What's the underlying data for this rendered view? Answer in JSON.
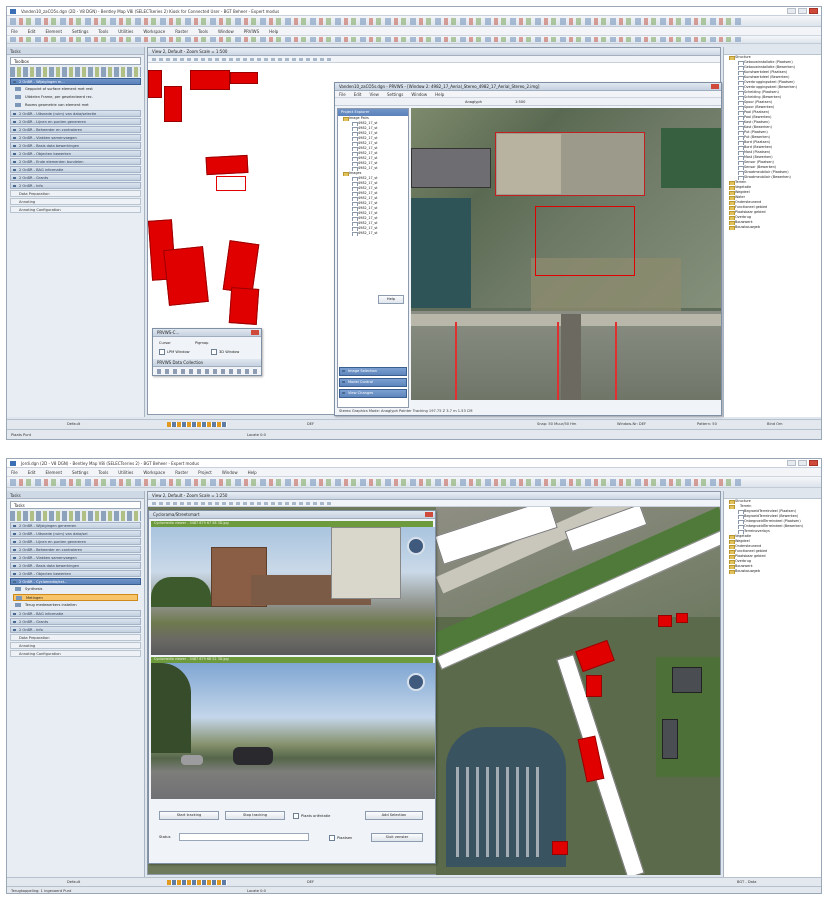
{
  "screenshot1": {
    "title": "Vanden10_zaCO5s.dgn (2D - V8 DGN) - Bentley Map V8i (SELECTseries 2) Kiosk for Connected User - BGT Beheer - Expert modus",
    "menu": [
      "File",
      "Edit",
      "Element",
      "Settings",
      "Tools",
      "Utilities",
      "Workspace",
      "Raster",
      "Tools",
      "Window",
      "PRVIWS",
      "Help"
    ],
    "left_panel": {
      "header": "Tasks",
      "combo": "Toolbox",
      "active_group": "2 OnBR - Wijzigingen m...",
      "active_items": [
        "Geppoint of surface element met rest",
        "Uitdelen Frame, per geselecteerd rec.",
        "Rooms geometrie van element met"
      ],
      "groups": [
        "2 OnBR - Uitsnede (ruim) van data/selectie",
        "2 OnBR - Lijnen en punten genereren",
        "2 OnBR - Beheerder en controleren",
        "2 OnBR - Vlakken samenvoegen",
        "2 OnBR - Basis data bewerkingen",
        "2 OnBR - Objecten bewerken",
        "2 OnBR - Ende elementen bundelen",
        "2 OnBR - BAG informatie",
        "2 OnBR - Grants",
        "2 OnBR - Info"
      ],
      "plain": [
        "Data Preparation",
        "Annoting",
        "Annoting Configuration"
      ]
    },
    "view_title": "View 2, Default - Zoom Scale = 1:500",
    "stereo_window": {
      "title": "Vanden10_zaCO5s.dgn - PRVWS - [Window 2: 4982_17_Aerial_Stereo_4982_17_Aerial_Stereo_2.img]",
      "menu": [
        "File",
        "Edit",
        "View",
        "Settings",
        "Window",
        "Help"
      ],
      "panel_header": "Project Explorer",
      "group_label": "Image Pairs",
      "images_label": "Images",
      "pair_items": [
        "4982_17_st",
        "4982_17_st",
        "4982_17_st",
        "4982_17_st",
        "4982_17_st",
        "4982_17_st",
        "4982_17_st",
        "4982_17_st",
        "4982_17_st",
        "4982_17_st"
      ],
      "image_items": [
        "4982_17_st",
        "4982_17_st",
        "4982_17_st",
        "4982_17_st",
        "4982_17_st",
        "4982_17_st",
        "4982_17_st",
        "4982_17_st",
        "4982_17_st",
        "4982_17_st",
        "4982_17_st",
        "4982_17_st"
      ],
      "help_button": "Help",
      "side_tabs": [
        "Image Selection",
        "Model Control",
        "View Changes"
      ],
      "mode_label": "Anaglyph",
      "zoom_label": "1:500",
      "status": "Stereo Graphics Mode: Anaglyph Pointer Tracking 197.75 Z 3.7 m 1.53 CM"
    },
    "mini_panel": {
      "title": "PRVWS-C...",
      "labels": [
        "Cursor",
        "Pigmap"
      ],
      "checks": [
        "LPM Window",
        "3D Window"
      ],
      "tools_title": "PRVWS Data Collection"
    },
    "right_tree": {
      "root": "Structure",
      "items": [
        "Gebouwinstallatie (Plaatsen)",
        "Gebouwinstallatie (Bewerken)",
        "Kunstwerkdeel (Plaatsen)",
        "Kunstwerkdeel (Bewerken)",
        "Overbruggingsdeel (Plaatsen)",
        "Overbruggingsdeel (Bewerken)",
        "Scheiding (Plaatsen)",
        "Scheiding (Bewerken)",
        "Spoor (Plaatsen)",
        "Spoor (Bewerken)",
        "Paal (Plaatsen)",
        "Paal (Bewerken)",
        "Kast (Plaatsen)",
        "Kast (Bewerken)",
        "Put (Plaatsen)",
        "Put (Bewerken)",
        "Bord (Plaatsen)",
        "Bord (Bewerken)",
        "Mast (Plaatsen)",
        "Mast (Bewerken)",
        "Sensor (Plaatsen)",
        "Sensor (Bewerken)",
        "Straatmeubilair (Plaatsen)",
        "Straatmeubilair (Bewerken)"
      ],
      "folders": [
        "Terrein",
        "Vegetatie",
        "Wegdeel",
        "Water",
        "Ondersteunend",
        "Functioneel gebied",
        "Plaatsbaar gebied",
        "Overbrug",
        "Bouwwerk",
        "Bouwbouwgeb"
      ]
    },
    "status_left": "Plaats Punt",
    "status_fields": [
      "Default",
      "DEF",
      "Locate 0:0",
      "Snap: 50 Muur/50 Hm",
      "Window-Nr: DEF",
      "Pattern: 50",
      "Bind Om"
    ]
  },
  "screenshot2": {
    "title": "Jordi.dgn (2D - V8 DGN) - Bentley Map V8i (SELECTseries 2) - BGT Beheer - Expert modus",
    "menu": [
      "File",
      "Edit",
      "Element",
      "Settings",
      "Tools",
      "Utilities",
      "Workspace",
      "Raster",
      "Project",
      "Window",
      "Help"
    ],
    "left_panel": {
      "header": "Tasks",
      "combo": "Tasks",
      "groups": [
        "2 OnBR - Wijzigingen genereren",
        "2 OnBR - Uitsnede (ruim) van data/sel",
        "2 OnBR - Lijnen en punten genereren",
        "2 OnBR - Beheerder en controleren",
        "2 OnBR - Vlakken samenvoegen",
        "2 OnBR - Basis data bewerkingen",
        "2 OnBR - Objecten bewerken"
      ],
      "active_group": "2 OnBR - Cyclomedia/ext...",
      "active_items": [
        "Synthesis",
        "Metingen",
        "Terug medewerkers instellen"
      ],
      "groups2": [
        "2 OnBR - BAG informatie",
        "2 OnBR - Grants",
        "2 OnBR - Info"
      ],
      "plain": [
        "Data Preparation",
        "Annoting",
        "Annoting Configuration"
      ]
    },
    "view_title": "View 2, Default - Zoom Scale = 1:250",
    "cyclorama": {
      "title": "Cyclorama/Streetsmart",
      "bar1": "Cyclomedia viewer - 3487 879 67 58 3D.jpg",
      "bar2": "Cyclomedia viewer - 3487 879 68 52 3D.jpg",
      "buttons": [
        "Start tracking",
        "Stop tracking",
        "Add Selection"
      ],
      "check": "Plaats oriëntatie",
      "field_label": "Status",
      "check2": "Plaatsen",
      "close_button": "Sluit venster"
    },
    "right_tree": {
      "root": "Structure",
      "subroot": "Terrein",
      "items": [
        "BegroeidTerreindeel (Plaatsen)",
        "BegroeidTerreindeel (Bewerken)",
        "OnbegroeidTerreindeel (Plaatsen)",
        "OnbegroeidTerreindeel (Bewerken)",
        "Terreinoverlays"
      ],
      "folders": [
        "Vegetatie",
        "Wegdeel",
        "Ondersteunend",
        "Functioneel gebied",
        "Plaatsbaar gebied",
        "Overbrug",
        "Bouwwerk",
        "Bouwbouwgeb"
      ]
    },
    "status_left": "Terugkoppeling: 1 ingevoerd Punt",
    "status_fields": [
      "Default",
      "DEF",
      "Locate 0:0",
      "BGT - Data"
    ]
  }
}
